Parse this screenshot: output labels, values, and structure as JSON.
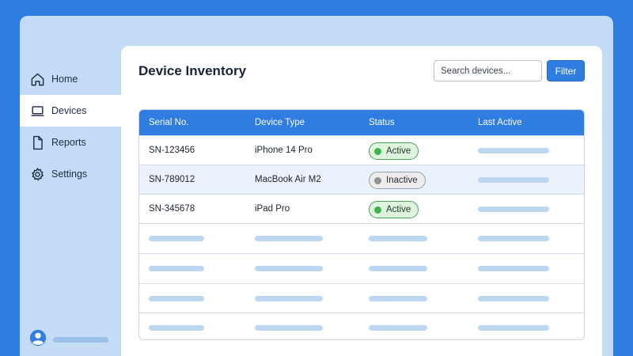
{
  "colors": {
    "background": "#2f7de0",
    "window": "#c4dcf6",
    "accent": "#2f7de0",
    "active_badge": "#3cb24a",
    "inactive_badge": "#8d9197"
  },
  "sidebar": {
    "items": [
      {
        "label": "Home",
        "icon": "home-icon",
        "active": false
      },
      {
        "label": "Devices",
        "icon": "laptop-icon",
        "active": true
      },
      {
        "label": "Reports",
        "icon": "document-icon",
        "active": false
      },
      {
        "label": "Settings",
        "icon": "gear-icon",
        "active": false
      }
    ],
    "user_icon": "user-avatar-icon"
  },
  "header": {
    "title": "Device Inventory",
    "search_placeholder": "Search devices...",
    "filter_label": "Filter"
  },
  "table": {
    "columns": [
      "Serial No.",
      "Device Type",
      "Status",
      "Last Active"
    ],
    "rows": [
      {
        "serial": "SN-123456",
        "device_type": "iPhone 14 Pro",
        "status": "Active"
      },
      {
        "serial": "SN-789012",
        "device_type": "MacBook Air M2",
        "status": "Inactive"
      },
      {
        "serial": "SN-345678",
        "device_type": "iPad Pro",
        "status": "Active"
      }
    ]
  }
}
